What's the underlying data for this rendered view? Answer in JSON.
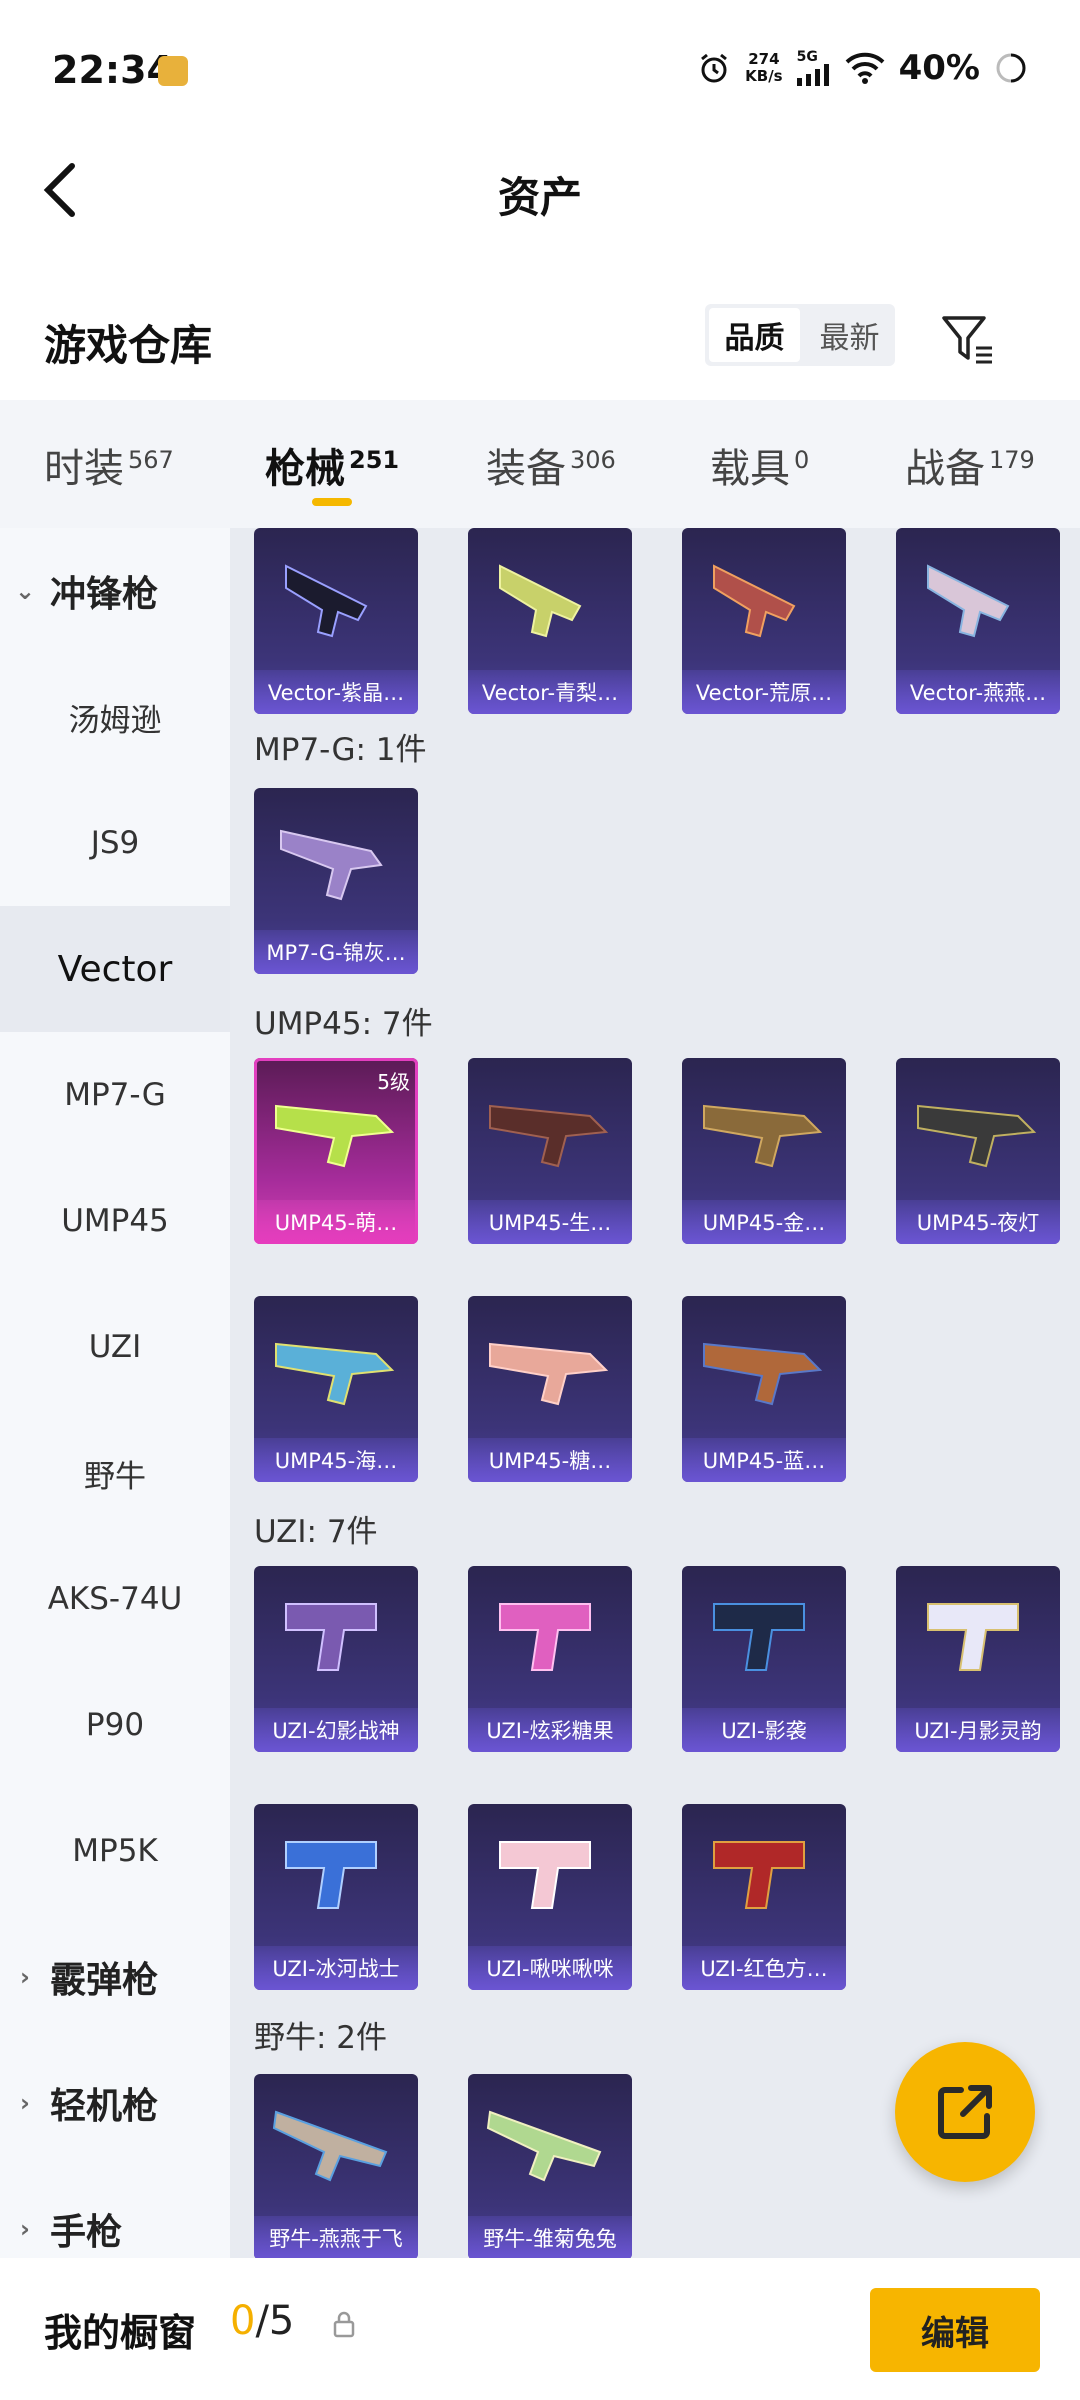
{
  "status": {
    "time": "22:34",
    "net_speed": "274",
    "net_unit": "KB/s",
    "signal": "5G",
    "battery": "40%"
  },
  "header": {
    "title": "资产"
  },
  "warehouse": {
    "title": "游戏仓库",
    "sort_quality": "品质",
    "sort_newest": "最新"
  },
  "tabs": [
    {
      "label": "时装",
      "count": "567"
    },
    {
      "label": "枪械",
      "count": "251"
    },
    {
      "label": "装备",
      "count": "306"
    },
    {
      "label": "载具",
      "count": "0"
    },
    {
      "label": "战备",
      "count": "179"
    }
  ],
  "sidebar": {
    "cat_smg": "冲锋枪",
    "items": [
      "汤姆逊",
      "JS9",
      "Vector",
      "MP7-G",
      "UMP45",
      "UZI",
      "野牛",
      "AKS-74U",
      "P90",
      "MP5K"
    ],
    "cat_shotgun": "霰弹枪",
    "cat_lmg": "轻机枪",
    "cat_pistol": "手枪"
  },
  "groups": {
    "vector": {
      "cards": [
        "Vector-紫晶…",
        "Vector-青梨…",
        "Vector-荒原…",
        "Vector-燕燕…"
      ]
    },
    "mp7g": {
      "title": "MP7-G: 1件",
      "cards": [
        "MP7-G-锦灰…"
      ]
    },
    "ump45": {
      "title": "UMP45: 7件",
      "level": "5级",
      "cards": [
        "UMP45-萌…",
        "UMP45-生…",
        "UMP45-金…",
        "UMP45-夜灯",
        "UMP45-海…",
        "UMP45-糖…",
        "UMP45-蓝…"
      ]
    },
    "uzi": {
      "title": "UZI: 7件",
      "cards": [
        "UZI-幻影战神",
        "UZI-炫彩糖果",
        "UZI-影袭",
        "UZI-月影灵韵",
        "UZI-冰河战士",
        "UZI-啾咪啾咪",
        "UZI-红色方…"
      ]
    },
    "bison": {
      "title": "野牛: 2件",
      "cards": [
        "野牛-燕燕于飞",
        "野牛-雏菊兔兔"
      ]
    }
  },
  "bottom": {
    "title": "我的橱窗",
    "count_current": "0",
    "count_total": "/5",
    "edit_label": "编辑"
  },
  "colors": {
    "accent": "#f7b500",
    "card_bg": "#3c3478",
    "card_pink": "#d441b4"
  }
}
